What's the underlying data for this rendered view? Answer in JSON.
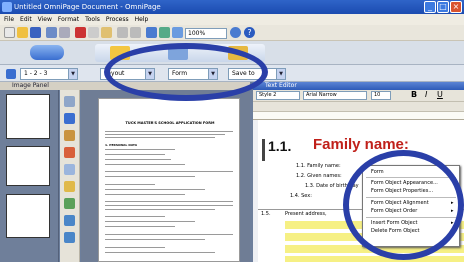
{
  "window": {
    "title": "Untitled OmniPage Document - OmniPage"
  },
  "menu": [
    "File",
    "Edit",
    "View",
    "Format",
    "Tools",
    "Process",
    "Help"
  ],
  "toolbar": {
    "zoom": "100%"
  },
  "toolbar3": {
    "page_range": "1 - 2 - 3",
    "layout": "Layout",
    "format": "Form",
    "save": "Save to"
  },
  "panels": {
    "image_panel": "Image Panel",
    "text_editor": "Text Editor"
  },
  "text_editor": {
    "style": "Style 2",
    "font": "Arial Narrow",
    "size": "10",
    "heading_num": "1.1.",
    "heading_text": "Family name:",
    "lines": [
      "1.1. Family name:",
      "1.2. Given names:",
      "1.3. Date of birth day",
      "1.4. Sex:"
    ],
    "row_15": "1.5.",
    "row_15_text": "Present address, "
  },
  "document": {
    "title": "TUCK MASTER'S SCHOOL APPLICATION FORM",
    "section": "1. PERSONAL DATA"
  },
  "thumbnails": [
    {
      "page": "1"
    },
    {
      "page": "2"
    },
    {
      "page": "3"
    }
  ],
  "context_menu": [
    "Form",
    "Form Object Appearance...",
    "Form Object Properties...",
    "Form Object Alignment",
    "Form Object Order",
    "Insert Form Object",
    "Delete Form Object"
  ],
  "colors": {
    "annotation": "#2a3fa8",
    "heading_red": "#c0201a",
    "highlight": "#f6f084"
  }
}
